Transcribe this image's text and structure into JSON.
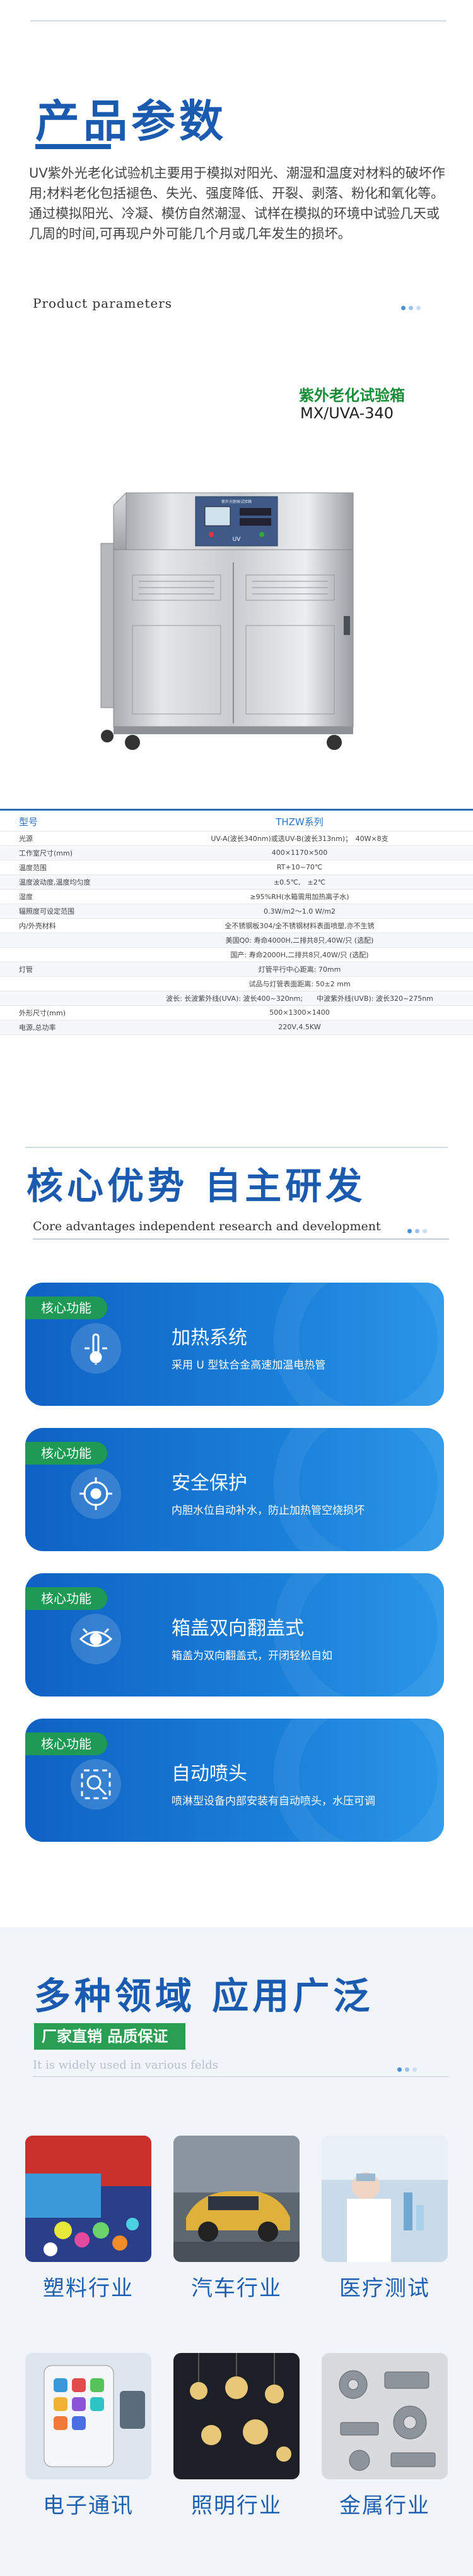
{
  "section1": {
    "title": "产品参数",
    "intro_1": "UV紫外光老化试验机主要用于模拟对阳光、潮湿和温度对材料的破坏作用;材料老化包括褪色、失光、强度降低、开裂、剥落、粉化和氧化等。",
    "intro_2": "通过模拟阳光、冷凝、模仿自然潮湿、试样在模拟的环境中试验几天或几周的时间,可再现户外可能几个月或几年发生的损坏。",
    "subtitle_en": "Product parameters",
    "machine_title": "紫外老化试验箱",
    "machine_model": "MX/UVA-340",
    "machine_panel_text": "UV",
    "spec_header": {
      "k": "型号",
      "v": "THZW系列"
    },
    "spec_rows": [
      {
        "k": "光源",
        "v": "UV-A(波长340nm)或选UV-B(波长313nm)；　40W×8支"
      },
      {
        "k": "工作室尺寸(mm)",
        "v": "400×1170×500"
      },
      {
        "k": "温度范围",
        "v": "RT+10~70℃"
      },
      {
        "k": "温度波动度,温度均匀度",
        "v": "±0.5℃,　±2℃"
      },
      {
        "k": "湿度",
        "v": "≥95%RH(水箱需用加热离子水)"
      },
      {
        "k": "辐照度可设定范围",
        "v": "0.3W/m2～1.0 W/m2"
      },
      {
        "k": "内/外壳材料",
        "v": "全不锈钢板304/全不锈钢材料表面喷塑,亦不生锈"
      },
      {
        "k": "",
        "v": "美国Q0: 寿命4000H,二排共8只,40W/只 (选配)"
      },
      {
        "k": "",
        "v": "国产: 寿命2000H,二排共8只,40W/只 (选配)"
      },
      {
        "k": "灯管",
        "v": "灯管平行中心距离: 70mm"
      },
      {
        "k": "",
        "v": "试品与灯管表面距离: 50±2 mm"
      },
      {
        "k": "",
        "v": "波长: 长波紫外线(UVA): 波长400~320nm;　　中波紫外线(UVB): 波长320~275nm"
      },
      {
        "k": "外形尺寸(mm)",
        "v": "500×1300×1400"
      },
      {
        "k": "电源,总功率",
        "v": "220V,4.5KW"
      }
    ]
  },
  "section2": {
    "title": "核心优势 自主研发",
    "subtitle_en": "Core advantages independent research and development",
    "cards": [
      {
        "tag": "核心功能",
        "heading": "加热系统",
        "desc": "采用 U 型钛合金高速加温电热管",
        "icon": "thermometer-icon"
      },
      {
        "tag": "核心功能",
        "heading": "安全保护",
        "desc": "内胆水位自动补水，防止加热管空烧损坏",
        "icon": "target-icon"
      },
      {
        "tag": "核心功能",
        "heading": "箱盖双向翻盖式",
        "desc": "箱盖为双向翻盖式，开闭轻松自如",
        "icon": "eye-icon"
      },
      {
        "tag": "核心功能",
        "heading": "自动喷头",
        "desc": "喷淋型设备内部安装有自动喷头，水压可调",
        "icon": "magnifier-icon"
      }
    ]
  },
  "section3": {
    "title": "多种领域 应用广泛",
    "ribbon": "厂家直销 品质保证",
    "subtitle_en": "It is widely used in various felds",
    "tiles": [
      {
        "label": "塑料行业"
      },
      {
        "label": "汽车行业"
      },
      {
        "label": "医疗测试"
      },
      {
        "label": "电子通讯"
      },
      {
        "label": "照明行业"
      },
      {
        "label": "金属行业"
      }
    ]
  },
  "colors": {
    "brand_blue": "#1a5bb0",
    "green": "#1f9a55",
    "dot_blue": "#4a90d9"
  }
}
